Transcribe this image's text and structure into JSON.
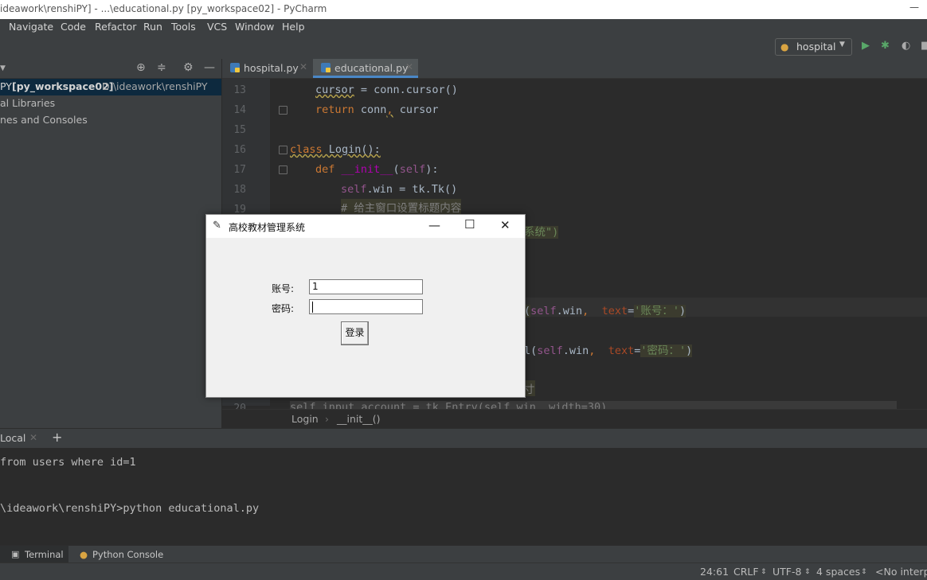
{
  "window": {
    "title": "ideawork\\renshiPY] - ...\\educational.py [py_workspace02] - PyCharm"
  },
  "menu": [
    "Navigate",
    "Code",
    "Refactor",
    "Run",
    "Tools",
    "VCS",
    "Window",
    "Help"
  ],
  "toolbar": {
    "run_config": "hospital"
  },
  "project": {
    "rows": [
      {
        "name": "PY",
        "bold": "[py_workspace02]",
        "path": "D:\\ideawork\\renshiPY"
      },
      {
        "name": "al Libraries"
      },
      {
        "name": "nes and Consoles"
      }
    ]
  },
  "editor": {
    "tabs": [
      {
        "label": "hospital.py",
        "active": false
      },
      {
        "label": "educational.py",
        "active": true
      }
    ],
    "line_numbers": [
      "13",
      "14",
      "15",
      "16",
      "17",
      "18",
      "19",
      "20"
    ],
    "code": {
      "l13a": "cursor",
      "l13b": " = conn.cursor()",
      "l14a": "return",
      "l14b": " conn",
      "l14c": ",",
      "l14d": " cursor",
      "l16a": "class",
      "l16b": " Login():",
      "l17a": "def",
      "l17b": " __init__",
      "l17c": "(",
      "l17d": "self",
      "l17e": "):",
      "l18a": "self",
      "l18b": ".win = tk.Tk()",
      "l19": "# 给主窗口设置标题内容",
      "l20": "系统\")",
      "l24a": "(",
      "l24b": "self",
      "l24c": ".win",
      "l24d": ",  ",
      "l24e": "text",
      "l24f": "=",
      "l24g": "'账号：'",
      "l24h": ")",
      "l26a": "l(",
      "l26b": "self",
      "l26c": ".win",
      "l26d": ",  ",
      "l26e": "text",
      "l26f": "=",
      "l26g": "'密码：'",
      "l26h": ")",
      "l28": "寸",
      "l29": "self.input_account = tk.Entry(self.win, width=30)"
    },
    "breadcrumb": [
      "Login",
      "__init__()"
    ]
  },
  "terminal": {
    "tab": "Local",
    "lines": [
      "from users where id=1",
      "\\ideawork\\renshiPY>python educational.py"
    ]
  },
  "toolwindows": {
    "terminal": "Terminal",
    "python_console": "Python Console"
  },
  "status": {
    "position": "24:61",
    "line_sep": "CRLF",
    "encoding": "UTF-8",
    "indent": "4 spaces",
    "interpreter": "<No interp"
  },
  "dialog": {
    "title": "高校教材管理系统",
    "account_label": "账号:",
    "account_value": "1",
    "password_label": "密码:",
    "password_value": "",
    "login_button": "登录"
  }
}
